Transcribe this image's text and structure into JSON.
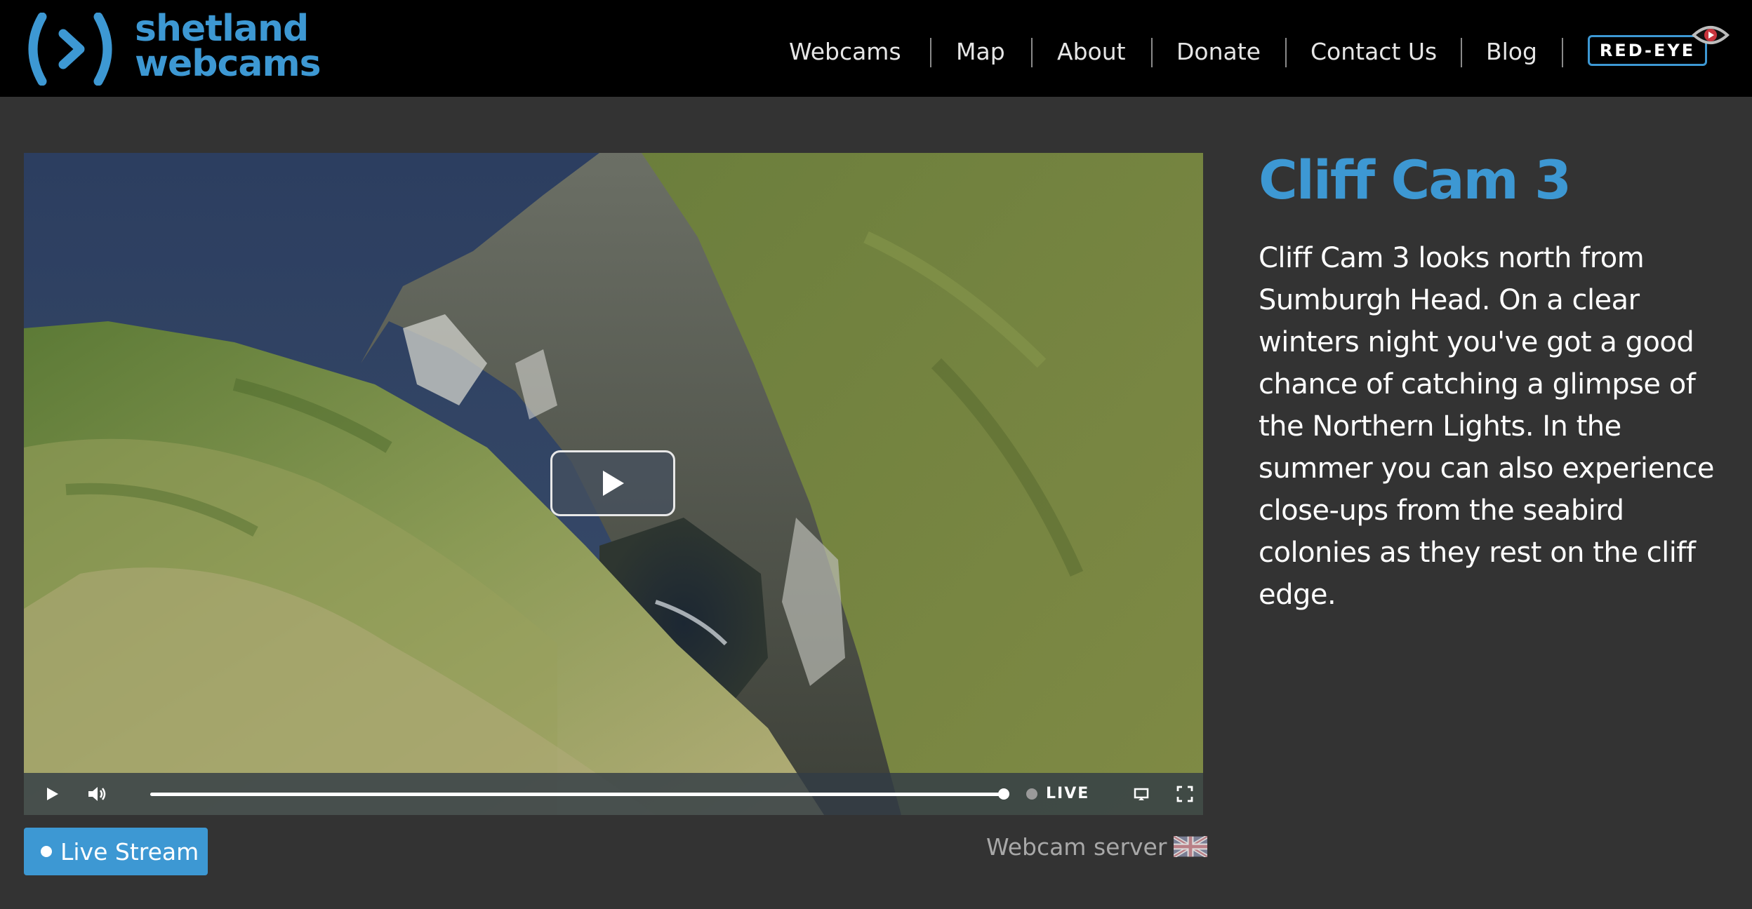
{
  "brand": {
    "line1": "shetland",
    "line2": "webcams",
    "color": "#3d98d3"
  },
  "nav": {
    "items": [
      {
        "label": "Webcams"
      },
      {
        "label": "Map"
      },
      {
        "label": "About"
      },
      {
        "label": "Donate"
      },
      {
        "label": "Contact Us"
      },
      {
        "label": "Blog"
      }
    ],
    "redeye_label": "RED-EYE"
  },
  "player": {
    "live_label": "LIVE",
    "progress": 1.0,
    "icons": [
      "play-icon",
      "volume-icon",
      "airplay-icon",
      "fullscreen-icon"
    ]
  },
  "stream": {
    "button_label": "Live Stream",
    "server_label": "Webcam server",
    "server_flag": "uk-flag-icon"
  },
  "camera": {
    "title": "Cliff Cam 3",
    "description": "Cliff Cam 3 looks north from Sumburgh Head. On a clear winters night you've got a good chance of catching a glimpse of the Northern Lights. In the summer you can also experience close-ups from the seabird colonies as they rest on the cliff edge."
  },
  "colors": {
    "accent": "#3d98d3",
    "background": "#333333",
    "header": "#000000"
  }
}
